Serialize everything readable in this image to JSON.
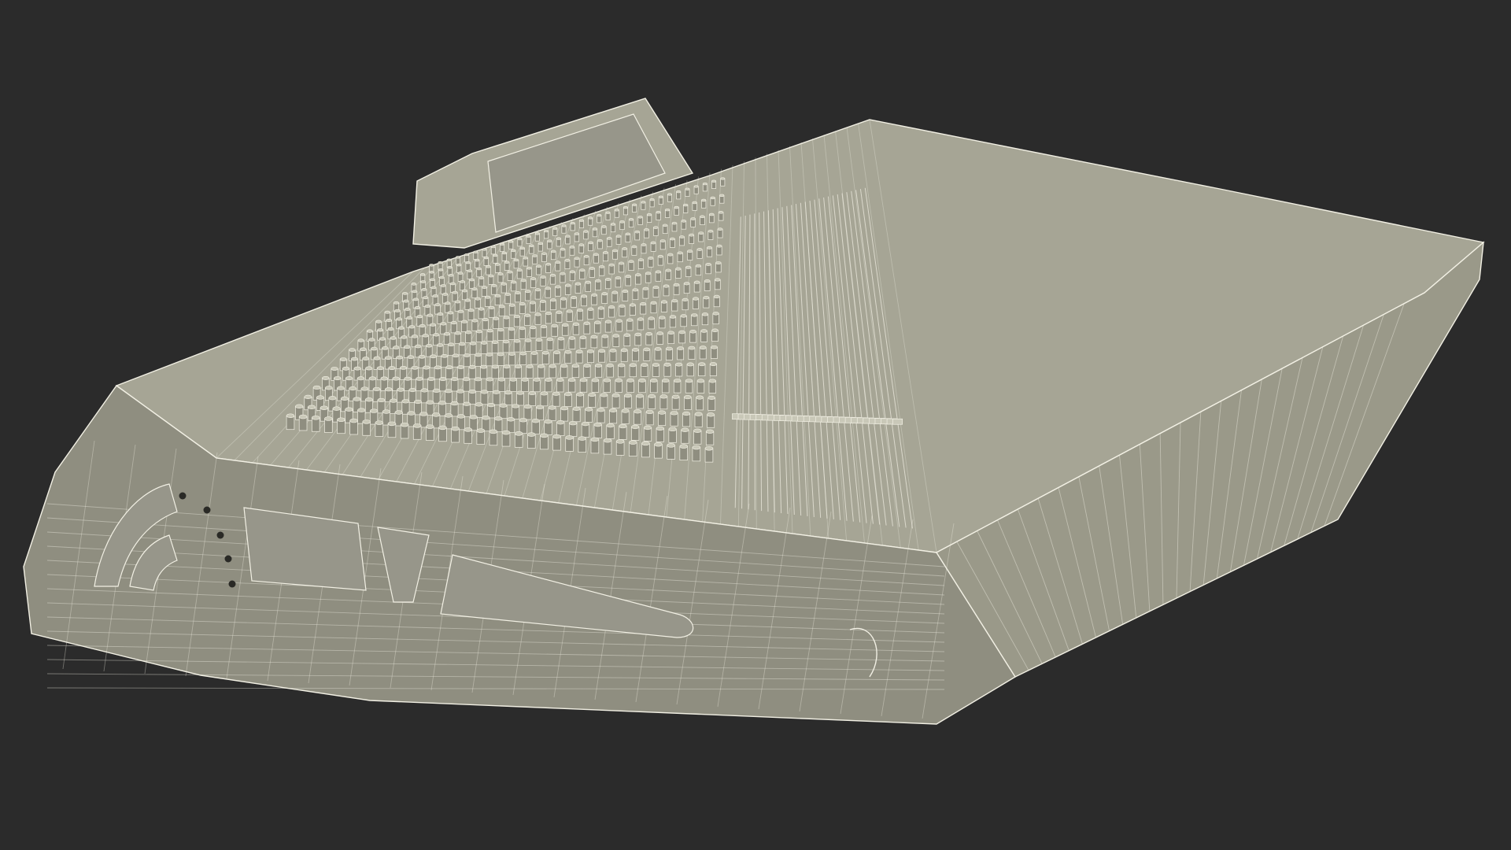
{
  "scene": {
    "subject": "",
    "background_color": "#2b2b2b",
    "model_fill_color": "#a6a595",
    "model_shade_color": "#8f8e80",
    "wire_color": "#f2f0e4",
    "hole_color": "#2a2a26",
    "knob_rows": 17,
    "knob_columns": 34,
    "fader_count": 28
  }
}
